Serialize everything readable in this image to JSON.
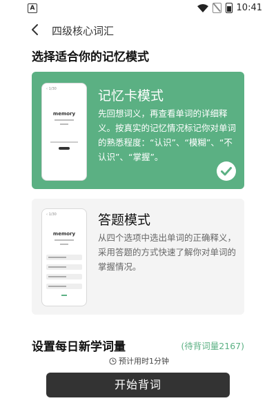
{
  "status_bar": {
    "sim_label": "A",
    "time": "10:41",
    "icons": [
      "wifi-icon",
      "no-sim-icon",
      "battery-icon"
    ]
  },
  "header": {
    "back_icon": "chevron-left-icon",
    "title": "四级核心词汇"
  },
  "section_title": "选择适合你的记忆模式",
  "modes": [
    {
      "title": "记忆卡模式",
      "description": "先回想词义，再查看单词的详细释义。按真实的记忆情况标记你对单词的熟悉程度：“认识”、“模糊”、“不认识”、“掌握”。",
      "selected": true,
      "preview_word": "memory",
      "preview_label": "1/30"
    },
    {
      "title": "答题模式",
      "description": "从四个选项中选出单词的正确释义，采用答题的方式快速了解你对单词的掌握情况。",
      "selected": false,
      "preview_word": "memory",
      "preview_label": "1/30"
    }
  ],
  "daily": {
    "title": "设置每日新学词量",
    "pending": "(待背词量2167)",
    "estimated_time": "预计用时1分钟"
  },
  "start_button": "开始背词",
  "colors": {
    "accent": "#5bb083",
    "button": "#333333",
    "card_inactive": "#f4f4f4"
  }
}
